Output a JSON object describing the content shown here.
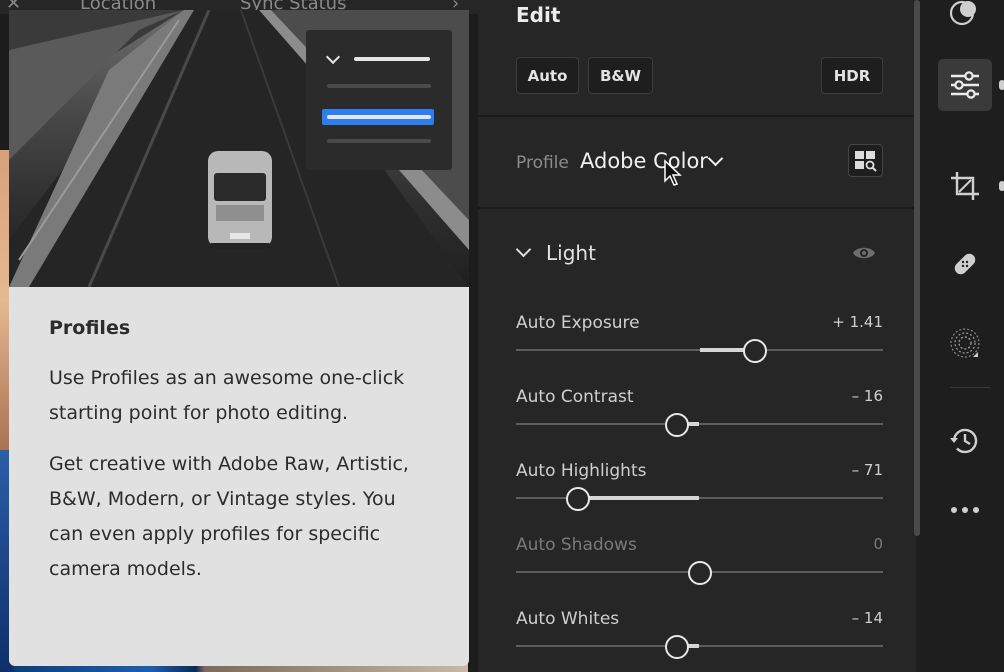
{
  "topbar": {
    "location_label": "Location",
    "sync_label": "Sync Status"
  },
  "popup": {
    "title": "Profiles",
    "paragraph_1": "Use Profiles as an awesome one-click starting point for photo editing.",
    "paragraph_2": "Get creative with Adobe Raw, Artistic, B&W, Modern, or Vintage styles. You can even apply profiles for specific camera models.",
    "illustration_menu_icon": "chevron-down-icon",
    "colors": {
      "card_bg": "#e1e1e1",
      "highlight": "#2d7ff0"
    }
  },
  "edit": {
    "title": "Edit",
    "buttons": {
      "auto": "Auto",
      "bw": "B&W",
      "hdr": "HDR"
    },
    "profile": {
      "label": "Profile",
      "value": "Adobe Color",
      "browse_icon": "grid-search-icon"
    },
    "light": {
      "label": "Light",
      "sliders": [
        {
          "label": "Auto Exposure",
          "value": "+ 1.41",
          "level": 0.65,
          "enabled": true
        },
        {
          "label": "Auto Contrast",
          "value": "– 16",
          "level": 0.44,
          "enabled": true
        },
        {
          "label": "Auto Highlights",
          "value": "– 71",
          "level": 0.17,
          "enabled": true
        },
        {
          "label": "Auto Shadows",
          "value": "0",
          "level": 0.5,
          "enabled": false
        },
        {
          "label": "Auto Whites",
          "value": "– 14",
          "level": 0.44,
          "enabled": true
        }
      ]
    }
  },
  "rail": {
    "tools": [
      "presets-icon",
      "edit-sliders-icon",
      "crop-icon",
      "healing-icon",
      "masking-icon",
      "history-icon",
      "more-icon"
    ],
    "active": "edit-sliders-icon"
  },
  "colors": {
    "panel_bg": "#262626",
    "rail_bg": "#1e1e1e",
    "accent": "#2d7ff0"
  }
}
